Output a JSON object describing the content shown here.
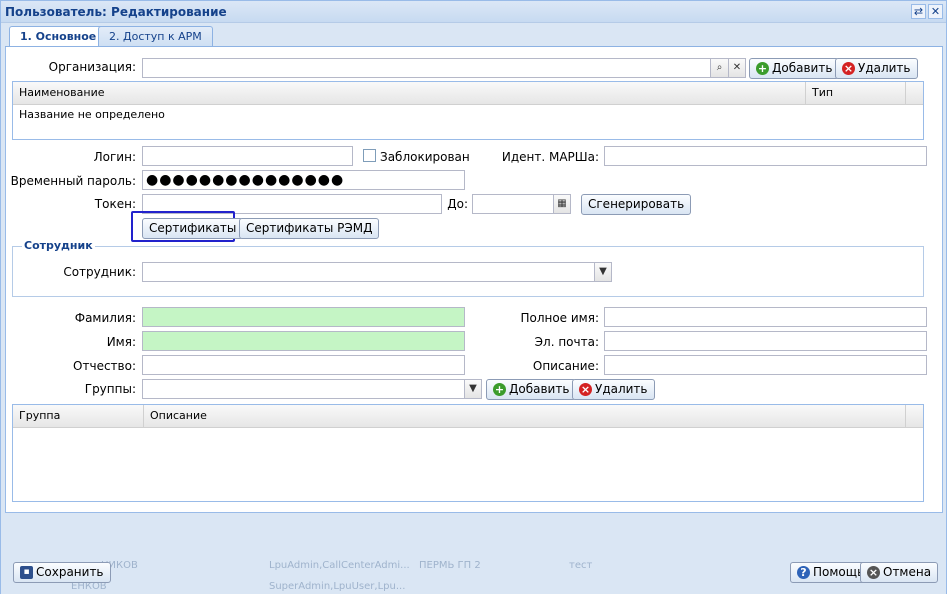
{
  "window": {
    "title": "Пользователь: Редактирование",
    "tool_refresh": "⇄",
    "tool_close": "✕"
  },
  "tabs": [
    {
      "label": "1. Основное"
    },
    {
      "label": "2. Доступ к АРМ"
    }
  ],
  "org": {
    "label": "Организация:",
    "value": "",
    "add_label": "Добавить",
    "delete_label": "Удалить"
  },
  "org_grid": {
    "columns": [
      "Наименование",
      "Тип"
    ],
    "rows": [
      {
        "name": "Название не определено",
        "type": ""
      }
    ]
  },
  "login": {
    "label": "Логин:",
    "value": "",
    "blocked_label": "Заблокирован",
    "mis_label": "Идент. МАРШа:",
    "mis_value": ""
  },
  "temp_password": {
    "label": "Временный пароль:",
    "value": "●●●●●●●●●●●●●●●"
  },
  "token": {
    "label": "Токен:",
    "value": "",
    "to_label": "До:",
    "to_value": "",
    "generate_label": "Сгенерировать"
  },
  "certs": {
    "certs_label": "Сертификаты",
    "remd_label": "Сертификаты РЭМД"
  },
  "employee": {
    "legend": "Сотрудник",
    "label": "Сотрудник:",
    "value": ""
  },
  "person": {
    "surname_label": "Фамилия:",
    "surname": "",
    "name_label": "Имя:",
    "name": "",
    "patronymic_label": "Отчество:",
    "patronymic": "",
    "fullname_label": "Полное имя:",
    "fullname": "",
    "email_label": "Эл. почта:",
    "email": "",
    "desc_label": "Описание:",
    "desc": ""
  },
  "groups": {
    "label": "Группы:",
    "value": "",
    "add_label": "Добавить",
    "delete_label": "Удалить",
    "columns": [
      "Группа",
      "Описание"
    ]
  },
  "footer": {
    "save_label": "Сохранить",
    "help_label": "Помощь",
    "cancel_label": "Отмена"
  },
  "background_rows": [
    {
      "c1": "НИКОВ",
      "c2": "LpuAdmin,CallCenterAdmi...",
      "c3": "ПЕРМЬ ГП 2",
      "c4": "тест"
    },
    {
      "c1": "ЕНКОВ",
      "c2": "SuperAdmin,LpuUser,Lpu..."
    }
  ],
  "colors": {
    "accent": "#15428b",
    "field_green": "#c5f5c5",
    "focus": "#2222cc"
  }
}
